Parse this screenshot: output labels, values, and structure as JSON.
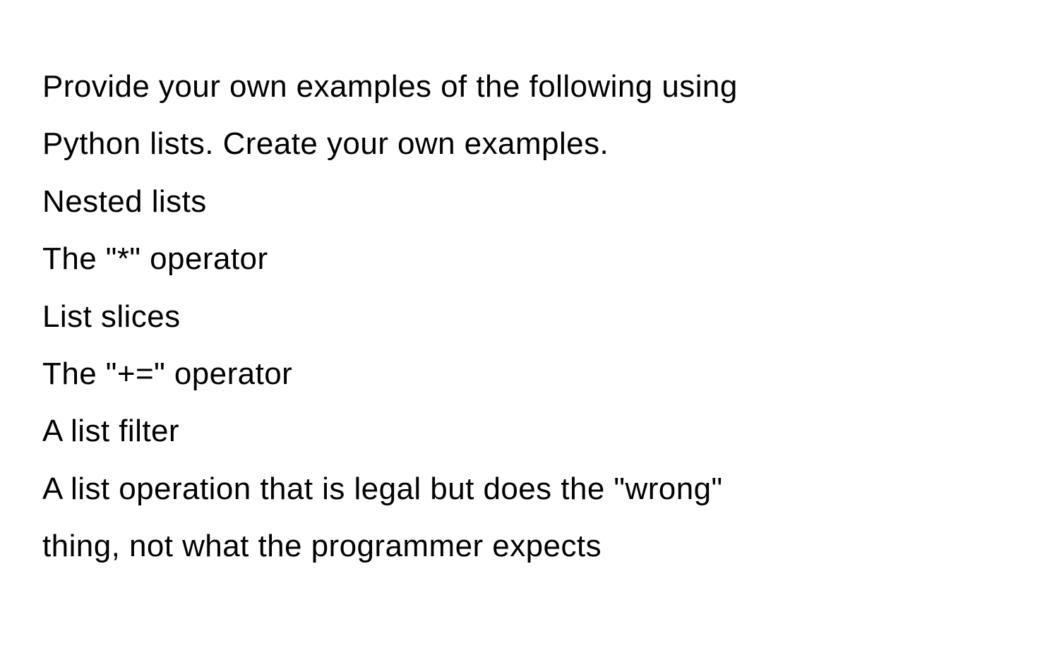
{
  "content": {
    "line1": "Provide your own examples of the following using",
    "line2": "Python lists. Create your own examples.",
    "line3": "Nested lists",
    "line4": "The \"*\" operator",
    "line5": "List slices",
    "line6": "The \"+=\" operator",
    "line7": "A list filter",
    "line8": "A list operation that is legal but does the \"wrong\"",
    "line9": "thing, not what the programmer expects"
  }
}
